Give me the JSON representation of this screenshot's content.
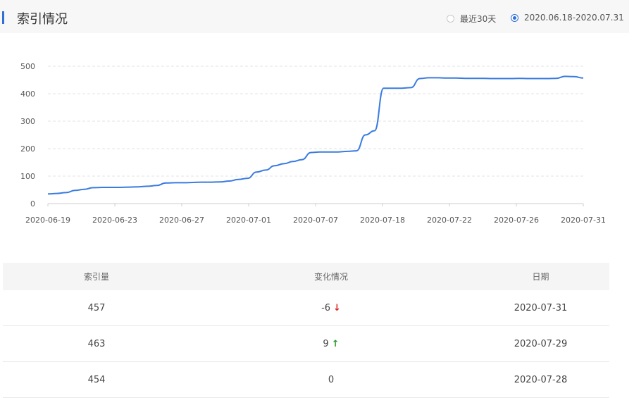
{
  "header": {
    "title": "索引情况",
    "options": [
      {
        "label": "最近30天",
        "selected": false
      },
      {
        "label": "2020.06.18-2020.07.31",
        "selected": true
      }
    ]
  },
  "chart_data": {
    "type": "line",
    "x_ticks": [
      "2020-06-19",
      "2020-06-23",
      "2020-06-27",
      "2020-07-01",
      "2020-07-07",
      "2020-07-18",
      "2020-07-22",
      "2020-07-26",
      "2020-07-31"
    ],
    "y_ticks": [
      0,
      100,
      200,
      300,
      400,
      500
    ],
    "ylim": [
      0,
      500
    ],
    "grid": true,
    "line_color": "#3a7be0",
    "series": [
      {
        "values": [
          35,
          37,
          40,
          48,
          52,
          58,
          59,
          59,
          59,
          60,
          61,
          63,
          66,
          75,
          76,
          76,
          77,
          78,
          78,
          79,
          82,
          88,
          92,
          115,
          122,
          138,
          145,
          153,
          160,
          186,
          188,
          188,
          188,
          190,
          192,
          250,
          265,
          420,
          420,
          420,
          422,
          455,
          458,
          458,
          457,
          457,
          456,
          456,
          456,
          455,
          455,
          455,
          456,
          455,
          455,
          455,
          456,
          463,
          462,
          457
        ]
      }
    ]
  },
  "table": {
    "headers": [
      "索引量",
      "变化情况",
      "日期"
    ],
    "rows": [
      {
        "count": "457",
        "change": "-6",
        "arrow": "↓",
        "trend": "down",
        "date": "2020-07-31"
      },
      {
        "count": "463",
        "change": "9",
        "arrow": "↑",
        "trend": "up",
        "date": "2020-07-29"
      },
      {
        "count": "454",
        "change": "0",
        "arrow": "",
        "trend": "none",
        "date": "2020-07-28"
      }
    ]
  }
}
